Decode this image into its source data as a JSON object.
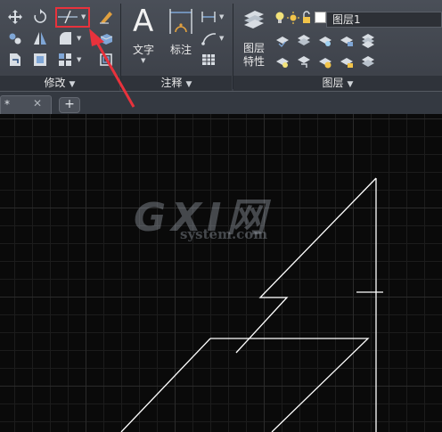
{
  "colors": {
    "highlight_box": "#e8323c",
    "arrow": "#e8323c",
    "drawing_lines": "#ffffff"
  },
  "ribbon": {
    "modify_panel": {
      "title": "修改",
      "icons": [
        "move-icon",
        "rotate-icon",
        "trim-icon",
        "erase-icon",
        "copy-icon",
        "mirror-icon",
        "fillet-icon",
        "explode-icon",
        "stretch-icon",
        "scale-icon",
        "array-icon",
        "offset-icon"
      ]
    },
    "annotation_panel": {
      "title": "注释",
      "text_label": "文字",
      "text_glyph": "A",
      "dimension_label": "标注"
    },
    "layers_panel": {
      "title": "图层",
      "layer_properties_label_line1": "图层",
      "layer_properties_label_line2": "特性",
      "current_layer": "图层1"
    }
  },
  "tabs": {
    "active_tab_marker": "*",
    "close_glyph": "✕",
    "new_tab_glyph": "+"
  },
  "watermark": {
    "main": "GXI网",
    "sub": "system.com"
  }
}
